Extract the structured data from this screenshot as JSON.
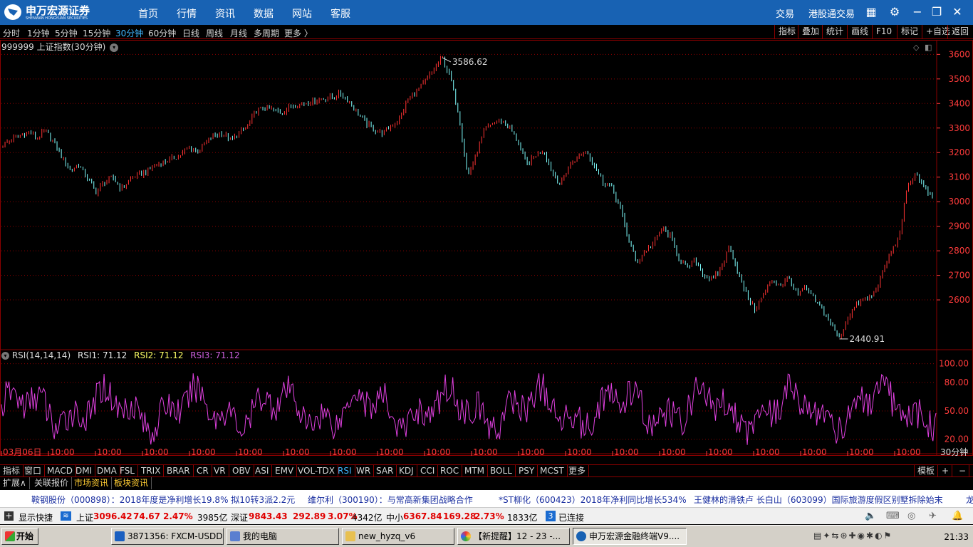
{
  "app": {
    "logo_name": "申万宏源证券",
    "logo_sub": "SHENWAN HONGYUAN SECURITIES",
    "menu": [
      "首页",
      "行情",
      "资讯",
      "数据",
      "网站",
      "客服"
    ],
    "right_menu": [
      "交易",
      "港股通交易"
    ],
    "icons": [
      "grid-icon",
      "gear-icon",
      "minimize-icon",
      "restore-icon",
      "close-icon"
    ]
  },
  "periods": {
    "items": [
      "分时",
      "1分钟",
      "5分钟",
      "15分钟",
      "30分钟",
      "60分钟",
      "日线",
      "周线",
      "月线",
      "多周期",
      "更多 〉"
    ],
    "active": "30分钟",
    "tools": [
      "指标",
      "叠加",
      "统计",
      "画线",
      "F10",
      "标记",
      "+自选",
      "返回"
    ]
  },
  "chart_header": {
    "symbol": "999999 上证指数(30分钟)"
  },
  "chart_data": {
    "type": "line",
    "y_ticks": [
      "3600",
      "3500",
      "3400",
      "3300",
      "3200",
      "3100",
      "3000",
      "2900",
      "2800",
      "2700",
      "2600"
    ],
    "ylim": [
      2400,
      3630
    ],
    "high_label": "3586.62",
    "low_label": "2440.91",
    "price_points": [
      3230,
      3255,
      3270,
      3285,
      3260,
      3290,
      3245,
      3180,
      3130,
      3150,
      3095,
      3040,
      3080,
      3100,
      3050,
      3090,
      3110,
      3120,
      3150,
      3160,
      3175,
      3190,
      3220,
      3205,
      3240,
      3270,
      3280,
      3250,
      3280,
      3310,
      3370,
      3385,
      3375,
      3360,
      3390,
      3395,
      3405,
      3415,
      3420,
      3425,
      3440,
      3410,
      3360,
      3320,
      3290,
      3280,
      3310,
      3340,
      3420,
      3450,
      3490,
      3540,
      3586.62,
      3500,
      3350,
      3100,
      3190,
      3290,
      3320,
      3330,
      3300,
      3240,
      3150,
      3190,
      3210,
      3120,
      3070,
      3150,
      3180,
      3210,
      3150,
      3080,
      3060,
      2980,
      2850,
      2750,
      2800,
      2830,
      2890,
      2860,
      2770,
      2730,
      2760,
      2700,
      2680,
      2730,
      2820,
      2710,
      2620,
      2560,
      2620,
      2680,
      2660,
      2690,
      2620,
      2650,
      2600,
      2560,
      2500,
      2440.91,
      2530,
      2580,
      2600,
      2620,
      2700,
      2790,
      2850,
      3050,
      3120,
      3060,
      3010
    ],
    "rsi_ticks": [
      "100.00",
      "80.00",
      "50.00",
      "20.00"
    ],
    "rsi_ylim": [
      10,
      105
    ],
    "x_labels": [
      "03月06日",
      "10:00",
      "10:00",
      "10:00",
      "10:00",
      "10:00",
      "10:00",
      "10:00",
      "10:00",
      "10:00",
      "10:00",
      "10:00",
      "10:00",
      "10:00",
      "10:00",
      "10:00",
      "10:00",
      "10:00",
      "10:00",
      "10:00"
    ],
    "x_right_label": "30分钟",
    "series_colors": {
      "price_up": "#ff3333",
      "price_down": "#7fffff",
      "rsi": "#e040e0",
      "grid": "#8b0000"
    }
  },
  "rsi": {
    "name": "RSI(14,14,14)",
    "rsi1": "RSI1: 71.12",
    "rsi2": "RSI2: 71.12",
    "rsi3": "RSI3: 71.12"
  },
  "indicators": {
    "items": [
      "指标",
      "窗口",
      "MACD",
      "DMI",
      "DMA",
      "FSL",
      "TRIX",
      "BRAR",
      "CR",
      "VR",
      "OBV",
      "ASI",
      "EMV",
      "VOL-TDX",
      "RSI",
      "WR",
      "SAR",
      "KDJ",
      "CCI",
      "ROC",
      "MTM",
      "BOLL",
      "PSY",
      "MCST",
      "更多"
    ],
    "active": "RSI",
    "right": [
      "模板",
      "+",
      "−"
    ]
  },
  "ext_tabs": [
    "扩展∧",
    "关联报价",
    "市场资讯",
    "板块资讯"
  ],
  "news": [
    "鞍钢股份（000898）：2018年度是净利增长19.8% 拟10转3派2.2元",
    "维尔利（300190）：与常高新集团战略合作",
    "*ST柳化（600423）2018年净利同比增长534%",
    "王健林的滑铁卢 长白山（603099）国际旅游度假区别墅拆除始末",
    "龙"
  ],
  "status": {
    "quick": "显示快捷",
    "sh_name": "上证",
    "sh_val": "3096.42",
    "sh_chg": "74.67",
    "sh_pct": "2.47%",
    "sh_amt": "3985亿",
    "sz_name": "深证",
    "sz_val": "9843.43",
    "sz_chg": "292.89",
    "sz_pct": "3.07%",
    "sz_amt": "4342亿",
    "zx_name": "中小",
    "zx_val": "6367.84",
    "zx_chg": "169.28",
    "zx_pct": "2.73%",
    "zx_amt": "1833亿",
    "conn_count": "3",
    "conn": "已连接"
  },
  "taskbar": {
    "start": "开始",
    "tasks": [
      "3871356: FXCM-USDDe...",
      "我的电脑",
      "new_hyzq_v6",
      "【新提醒】12 - 23 -...",
      "申万宏源金融终端V9...."
    ],
    "clock": "21:33"
  }
}
